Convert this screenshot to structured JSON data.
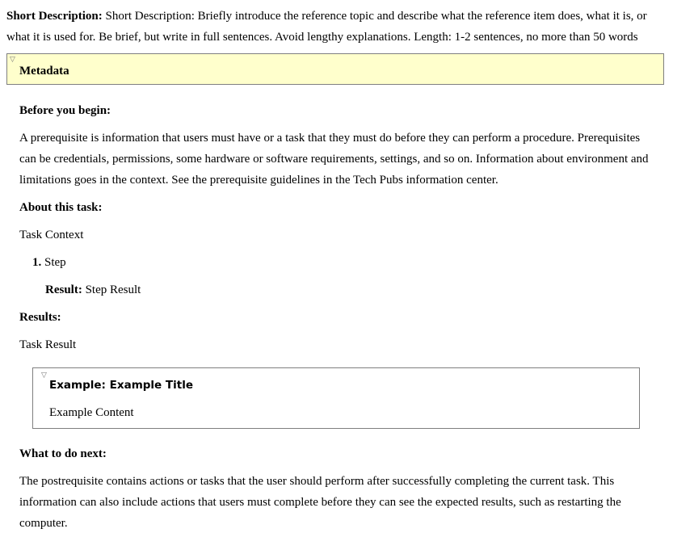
{
  "short_description": {
    "label": "Short Description:",
    "text": "Short Description: Briefly introduce the reference topic and describe what the reference item does, what it is, or what it is used for. Be brief, but write in full sentences. Avoid lengthy explanations. Length: 1-2 sentences, no more than 50 words"
  },
  "metadata": {
    "title": "Metadata",
    "toggle_icon": "triangle-down"
  },
  "prereq": {
    "heading": "Before you begin:",
    "text": "A prerequisite is information that users must have or a task that they must do before they can perform a procedure. Prerequisites can be credentials, permissions, some hardware or software requirements, settings, and so on. Information about environment and limitations goes in the context. See the prerequisite guidelines in the Tech Pubs information center."
  },
  "context": {
    "heading": "About this task:",
    "text": "Task Context"
  },
  "steps": [
    {
      "number": "1.",
      "text": "Step",
      "result_label": "Result:",
      "result_text": "Step Result"
    }
  ],
  "result": {
    "heading": "Results:",
    "text": "Task Result"
  },
  "example": {
    "title": "Example: Example Title",
    "content": "Example Content",
    "toggle_icon": "triangle-down"
  },
  "postreq": {
    "heading": "What to do next:",
    "text": "The postrequisite contains actions or tasks that the user should perform after successfully completing the current task. This information can also include actions that users must complete before they can see the expected results, such as restarting the computer."
  }
}
